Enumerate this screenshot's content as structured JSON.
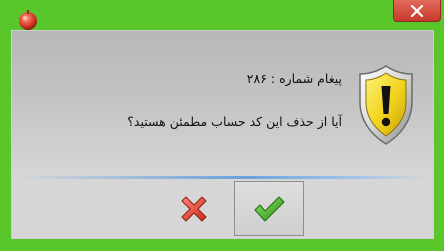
{
  "dialog": {
    "message_title": "پیغام شماره : ۲۸۶",
    "message_text": "آیا از حذف این کد حساب مطمئن هستید؟"
  },
  "buttons": {
    "cancel": "cancel-x-icon",
    "ok": "ok-checkmark-icon"
  },
  "colors": {
    "window_border": "#59c62c",
    "close_button": "#d04a3b",
    "content_gradient_top": "#b7b7b7",
    "separator_accent": "#6aa2dd",
    "ok_check": "#3fae23",
    "cancel_x": "#e2503f",
    "warning_shield": "#f1d21a"
  }
}
